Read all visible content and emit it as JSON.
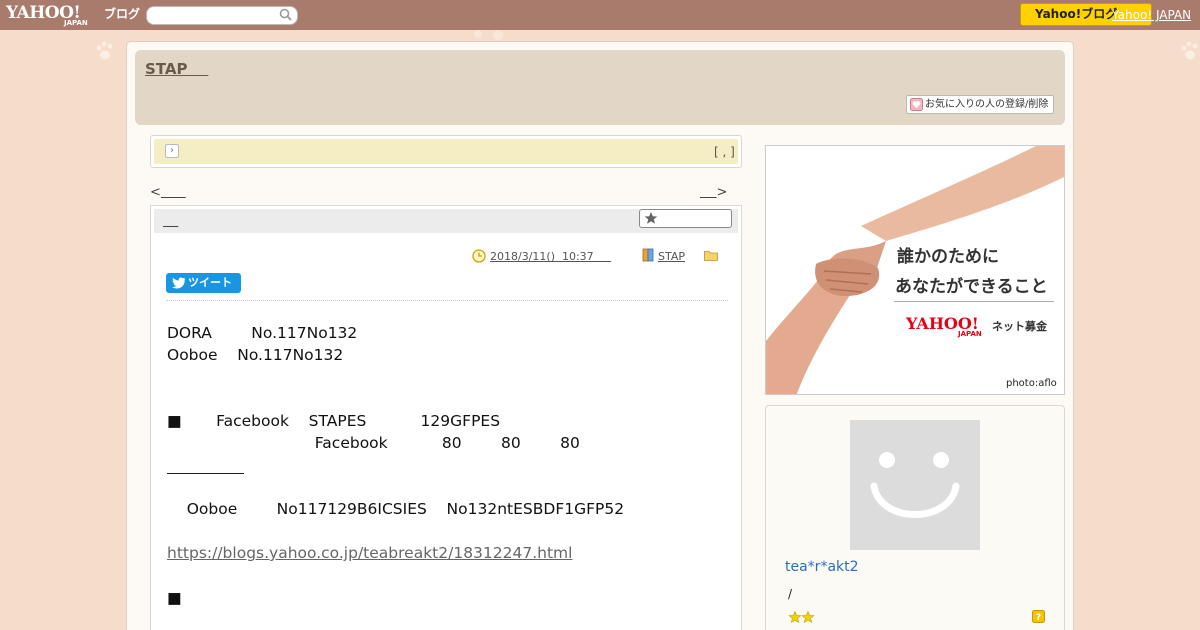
{
  "topbar": {
    "logo_main": "YAHOO!",
    "logo_sub": "JAPAN",
    "logo_service": "ブログ",
    "search_value": "",
    "button_label": "Yahoo!ブログ",
    "link_label": "Yahoo! JAPAN"
  },
  "header": {
    "blog_title": "STAP    ",
    "favorite_button": "お気に入りの人の登録/削除"
  },
  "notice": {
    "arrow": "›",
    "bracket": "[ , ]"
  },
  "nav": {
    "prev_prefix": "<",
    "prev_label": "      ",
    "next_label": "    ",
    "next_suffix": ">"
  },
  "article": {
    "title": "    ",
    "date": "2018/3/11()  10:37     ",
    "category": "STAP",
    "tweet_label": "ツイート",
    "lines": [
      "DORA        No.117No132",
      "Ooboe    No.117No132",
      "■       Facebook    STAPES           129GFPES",
      "                              Facebook           80        80        80",
      "    Ooboe        No117129B6ICSIES    No132ntESBDF1GFP52",
      "■"
    ],
    "link": "https://blogs.yahoo.co.jp/teabreakt2/18312247.html"
  },
  "ad": {
    "line1": "誰かのために",
    "line2": "あなたができること",
    "brand": "YAHOO!",
    "brand_sub": "JAPAN",
    "service": "ネット募金",
    "credit": "photo:aflo"
  },
  "profile": {
    "nickname": "tea*r*akt2",
    "slash": "/"
  },
  "colors": {
    "topbar": "#a97b6c",
    "background": "#f6dccb",
    "header": "#e2d7c6",
    "notice": "#f5edc4",
    "tweet": "#1b95e0",
    "yahoo_button": "#ffd100",
    "nickname": "#2a6ebb"
  },
  "icons": [
    "search-icon",
    "heart-icon",
    "star-icon",
    "clock-icon",
    "book-icon",
    "folder-icon",
    "bird-icon",
    "stars-icon",
    "help-icon"
  ]
}
